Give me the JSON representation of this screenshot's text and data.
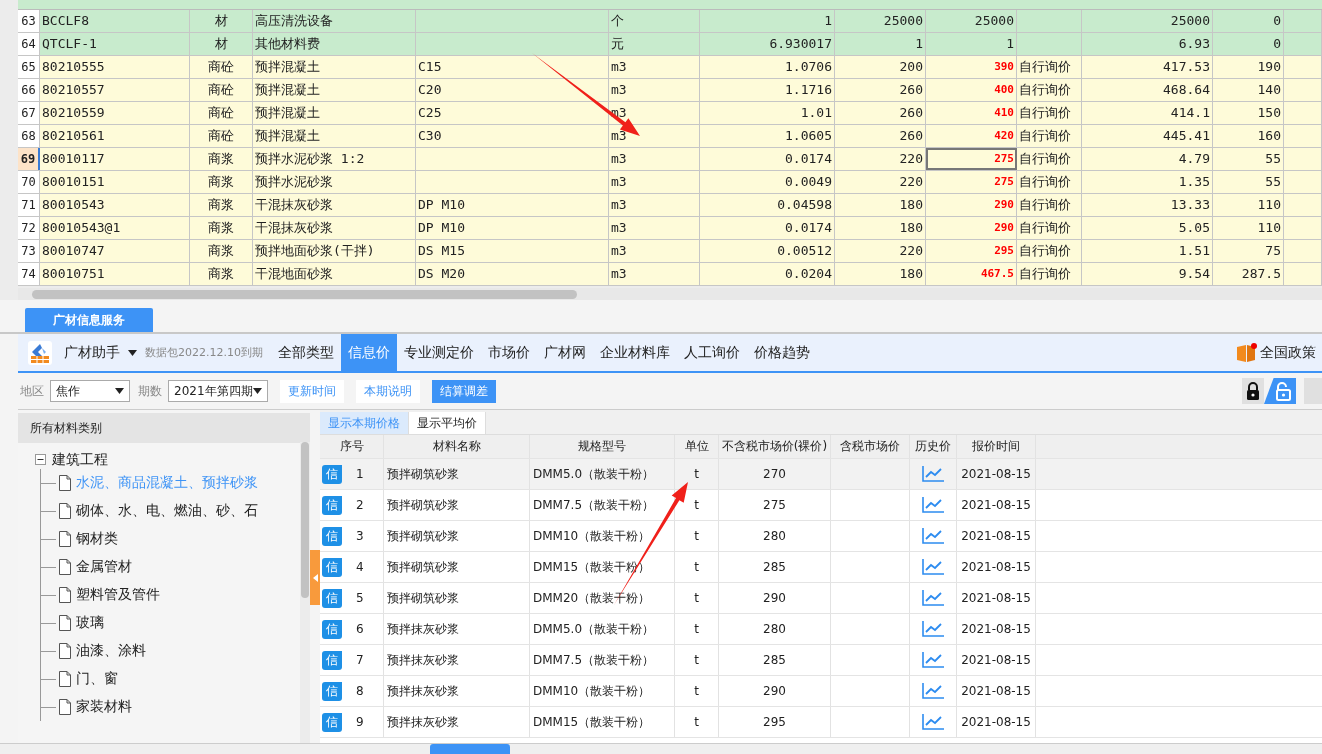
{
  "sheet": {
    "rows": [
      {
        "num": "63",
        "code": "BCCLF8",
        "type": "材",
        "name": "高压清洗设备",
        "spec": "",
        "unit": "个",
        "qty": "1",
        "price": "25000",
        "market": "25000",
        "note": "",
        "amount": "25000",
        "diff": "0",
        "kind": "material",
        "selected": false
      },
      {
        "num": "64",
        "code": "QTCLF-1",
        "type": "材",
        "name": "其他材料费",
        "spec": "",
        "unit": "元",
        "qty": "6.930017",
        "price": "1",
        "market": "1",
        "note": "",
        "amount": "6.93",
        "diff": "0",
        "kind": "material",
        "selected": false
      },
      {
        "num": "65",
        "code": "80210555",
        "type": "商砼",
        "name": "预拌混凝土",
        "spec": "C15",
        "unit": "m3",
        "qty": "1.0706",
        "price": "200",
        "market": "390",
        "note": "自行询价",
        "amount": "417.53",
        "diff": "190",
        "kind": "commodity",
        "selected": false
      },
      {
        "num": "66",
        "code": "80210557",
        "type": "商砼",
        "name": "预拌混凝土",
        "spec": "C20",
        "unit": "m3",
        "qty": "1.1716",
        "price": "260",
        "market": "400",
        "note": "自行询价",
        "amount": "468.64",
        "diff": "140",
        "kind": "commodity",
        "selected": false
      },
      {
        "num": "67",
        "code": "80210559",
        "type": "商砼",
        "name": "预拌混凝土",
        "spec": "C25",
        "unit": "m3",
        "qty": "1.01",
        "price": "260",
        "market": "410",
        "note": "自行询价",
        "amount": "414.1",
        "diff": "150",
        "kind": "commodity",
        "selected": false
      },
      {
        "num": "68",
        "code": "80210561",
        "type": "商砼",
        "name": "预拌混凝土",
        "spec": "C30",
        "unit": "m3",
        "qty": "1.0605",
        "price": "260",
        "market": "420",
        "note": "自行询价",
        "amount": "445.41",
        "diff": "160",
        "kind": "commodity",
        "selected": false
      },
      {
        "num": "69",
        "code": "80010117",
        "type": "商浆",
        "name": "预拌水泥砂浆 1:2",
        "spec": "",
        "unit": "m3",
        "qty": "0.0174",
        "price": "220",
        "market": "275",
        "note": "自行询价",
        "amount": "4.79",
        "diff": "55",
        "kind": "commodity",
        "selected": true
      },
      {
        "num": "70",
        "code": "80010151",
        "type": "商浆",
        "name": "预拌水泥砂浆",
        "spec": "",
        "unit": "m3",
        "qty": "0.0049",
        "price": "220",
        "market": "275",
        "note": "自行询价",
        "amount": "1.35",
        "diff": "55",
        "kind": "commodity",
        "selected": false
      },
      {
        "num": "71",
        "code": "80010543",
        "type": "商浆",
        "name": "干混抹灰砂浆",
        "spec": "DP M10",
        "unit": "m3",
        "qty": "0.04598",
        "price": "180",
        "market": "290",
        "note": "自行询价",
        "amount": "13.33",
        "diff": "110",
        "kind": "commodity",
        "selected": false
      },
      {
        "num": "72",
        "code": "80010543@1",
        "type": "商浆",
        "name": "干混抹灰砂浆",
        "spec": "DP M10",
        "unit": "m3",
        "qty": "0.0174",
        "price": "180",
        "market": "290",
        "note": "自行询价",
        "amount": "5.05",
        "diff": "110",
        "kind": "commodity",
        "selected": false
      },
      {
        "num": "73",
        "code": "80010747",
        "type": "商浆",
        "name": "预拌地面砂浆(干拌)",
        "spec": "DS M15",
        "unit": "m3",
        "qty": "0.00512",
        "price": "220",
        "market": "295",
        "note": "自行询价",
        "amount": "1.51",
        "diff": "75",
        "kind": "commodity",
        "selected": false
      },
      {
        "num": "74",
        "code": "80010751",
        "type": "商浆",
        "name": "干混地面砂浆",
        "spec": "DS M20",
        "unit": "m3",
        "qty": "0.0204",
        "price": "180",
        "market": "467.5",
        "note": "自行询价",
        "amount": "9.54",
        "diff": "287.5",
        "kind": "commodity",
        "selected": false
      }
    ]
  },
  "panel_tab": "广材信息服务",
  "toolbar": {
    "app": "广材助手",
    "expiry": "数据包2022.12.10到期",
    "nav": [
      {
        "label": "全部类型",
        "selected": false
      },
      {
        "label": "信息价",
        "selected": true
      },
      {
        "label": "专业测定价",
        "selected": false
      },
      {
        "label": "市场价",
        "selected": false
      },
      {
        "label": "广材网",
        "selected": false
      },
      {
        "label": "企业材料库",
        "selected": false
      },
      {
        "label": "人工询价",
        "selected": false
      },
      {
        "label": "价格趋势",
        "selected": false
      }
    ],
    "policy": "全国政策"
  },
  "filters": {
    "region_label": "地区",
    "region": "焦作",
    "period_label": "期数",
    "period": "2021年第四期",
    "buttons": [
      {
        "label": "更新时间",
        "selected": false
      },
      {
        "label": "本期说明",
        "selected": false
      },
      {
        "label": "结算调差",
        "selected": true
      }
    ]
  },
  "tree": {
    "title": "所有材料类别",
    "root": {
      "label": "建筑工程",
      "expanded": true,
      "children": [
        {
          "label": "水泥、商品混凝土、预拌砂浆",
          "selected": true
        },
        {
          "label": "砌体、水、电、燃油、砂、石",
          "selected": false
        },
        {
          "label": "钢材类",
          "selected": false
        },
        {
          "label": "金属管材",
          "selected": false
        },
        {
          "label": "塑料管及管件",
          "selected": false
        },
        {
          "label": "玻璃",
          "selected": false
        },
        {
          "label": "油漆、涂料",
          "selected": false
        },
        {
          "label": "门、窗",
          "selected": false
        },
        {
          "label": "家装材料",
          "selected": false
        }
      ]
    }
  },
  "price_tabs": [
    {
      "label": "显示本期价格",
      "selected": true
    },
    {
      "label": "显示平均价",
      "selected": false
    }
  ],
  "price_table": {
    "columns": [
      "序号",
      "材料名称",
      "规格型号",
      "单位",
      "不含税市场价(裸价)",
      "含税市场价",
      "历史价",
      "报价时间"
    ],
    "rows": [
      {
        "badge": "信",
        "num": "1",
        "name": "预拌砌筑砂浆",
        "spec": "DMM5.0（散装干粉）",
        "unit": "t",
        "price": "270",
        "time": "2021-08-15",
        "selected": true
      },
      {
        "badge": "信",
        "num": "2",
        "name": "预拌砌筑砂浆",
        "spec": "DMM7.5（散装干粉）",
        "unit": "t",
        "price": "275",
        "time": "2021-08-15",
        "selected": false
      },
      {
        "badge": "信",
        "num": "3",
        "name": "预拌砌筑砂浆",
        "spec": "DMM10（散装干粉）",
        "unit": "t",
        "price": "280",
        "time": "2021-08-15",
        "selected": false
      },
      {
        "badge": "信",
        "num": "4",
        "name": "预拌砌筑砂浆",
        "spec": "DMM15（散装干粉）",
        "unit": "t",
        "price": "285",
        "time": "2021-08-15",
        "selected": false
      },
      {
        "badge": "信",
        "num": "5",
        "name": "预拌砌筑砂浆",
        "spec": "DMM20（散装干粉）",
        "unit": "t",
        "price": "290",
        "time": "2021-08-15",
        "selected": false
      },
      {
        "badge": "信",
        "num": "6",
        "name": "预拌抹灰砂浆",
        "spec": "DMM5.0（散装干粉）",
        "unit": "t",
        "price": "280",
        "time": "2021-08-15",
        "selected": false
      },
      {
        "badge": "信",
        "num": "7",
        "name": "预拌抹灰砂浆",
        "spec": "DMM7.5（散装干粉）",
        "unit": "t",
        "price": "285",
        "time": "2021-08-15",
        "selected": false
      },
      {
        "badge": "信",
        "num": "8",
        "name": "预拌抹灰砂浆",
        "spec": "DMM10（散装干粉）",
        "unit": "t",
        "price": "290",
        "time": "2021-08-15",
        "selected": false
      },
      {
        "badge": "信",
        "num": "9",
        "name": "预拌抹灰砂浆",
        "spec": "DMM15（散装干粉）",
        "unit": "t",
        "price": "295",
        "time": "2021-08-15",
        "selected": false
      }
    ]
  }
}
